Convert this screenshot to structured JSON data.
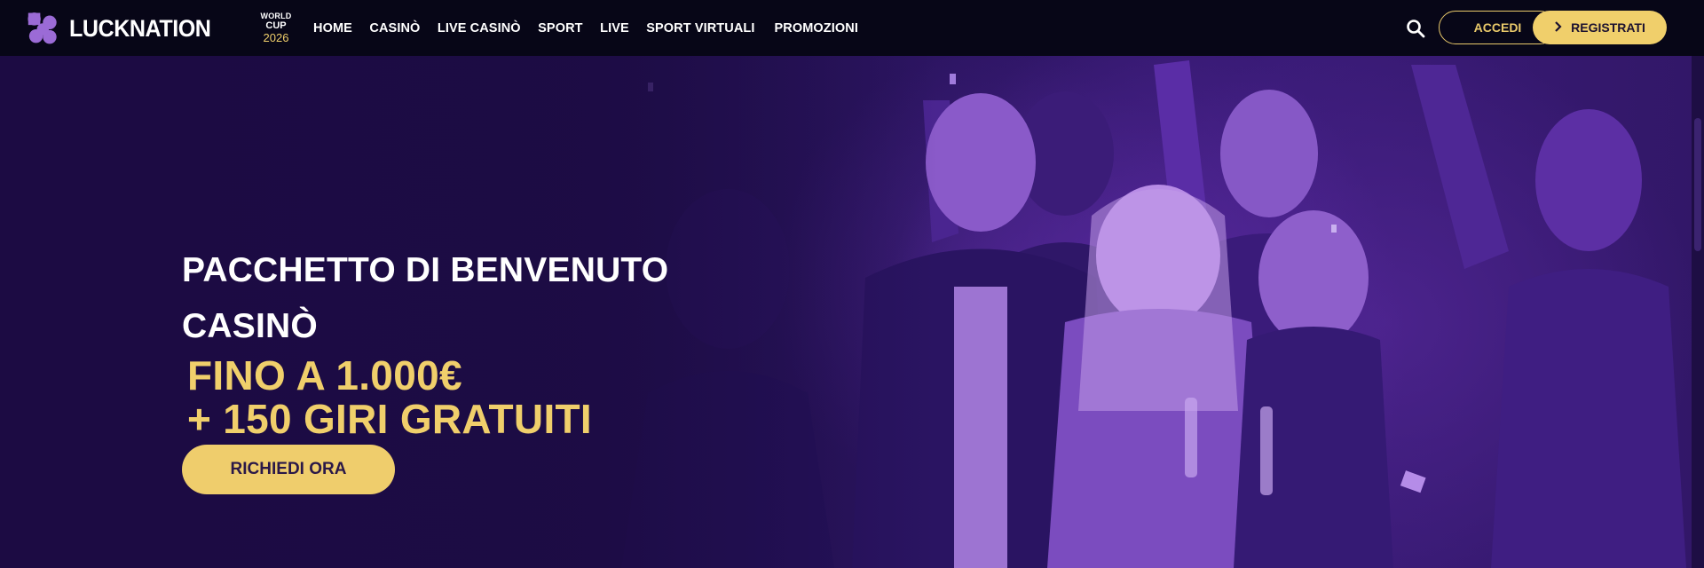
{
  "header": {
    "logo": "LUCKNATION",
    "world_cup": {
      "line1": "WORLD",
      "line2": "CUP",
      "line3": "2026"
    },
    "nav": [
      "HOME",
      "CASINÒ",
      "LIVE CASINÒ",
      "SPORT",
      "LIVE",
      "SPORT VIRTUALI",
      "PROMOZIONI"
    ],
    "search_icon": "search-icon",
    "login_label": "ACCEDI",
    "register_label": "REGISTRATI",
    "register_icon": "chevron-right-icon"
  },
  "hero": {
    "title_line1": "PACCHETTO DI BENVENUTO",
    "title_line2": "CASINÒ",
    "offer_line1": "FINO A 1.000€",
    "offer_line2": "+ 150 GIRI GRATUITI",
    "cta_label": "RICHIEDI ORA",
    "image": "party-crowd-celebrating-photo"
  },
  "colors": {
    "header_bg": "#070617",
    "accent_gold": "#f0cf6b",
    "hero_purple": "#2d1563",
    "text_white": "#ffffff"
  }
}
